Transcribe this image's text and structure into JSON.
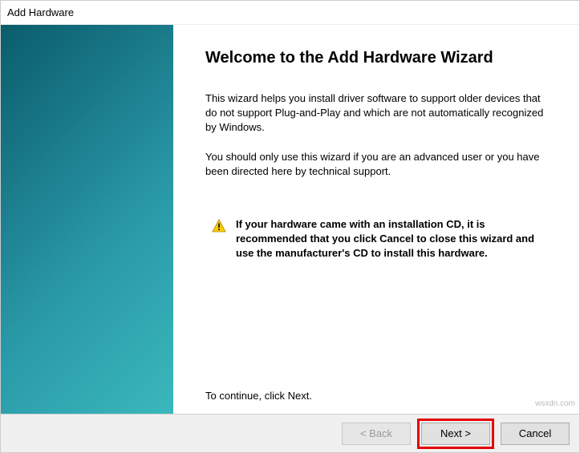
{
  "window": {
    "title": "Add Hardware"
  },
  "wizard": {
    "heading": "Welcome to the Add Hardware Wizard",
    "paragraph1": "This wizard helps you install driver software to support older devices that do not support Plug-and-Play and which are not automatically recognized by Windows.",
    "paragraph2": "You should only use this wizard if you are an advanced user or you have been directed here by technical support.",
    "warning": "If your hardware came with an installation CD, it is recommended that you click Cancel to close this wizard and use the manufacturer's CD to install this hardware.",
    "continue": "To continue, click Next."
  },
  "buttons": {
    "back": "< Back",
    "next": "Next >",
    "cancel": "Cancel"
  },
  "watermark": "wsxdn.com"
}
